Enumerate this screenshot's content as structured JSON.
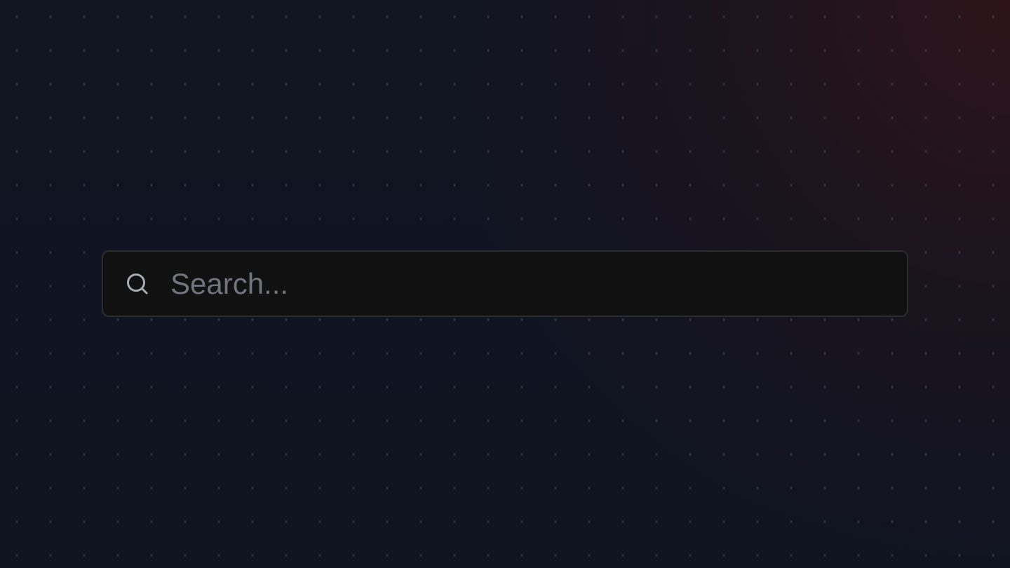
{
  "search": {
    "placeholder": "Search...",
    "value": "",
    "icon": "search-icon"
  },
  "colors": {
    "page_background": "#0f1320",
    "search_background": "#111111",
    "search_border": "#2b2d31",
    "placeholder": "#71747d",
    "icon": "#a7aab2"
  }
}
